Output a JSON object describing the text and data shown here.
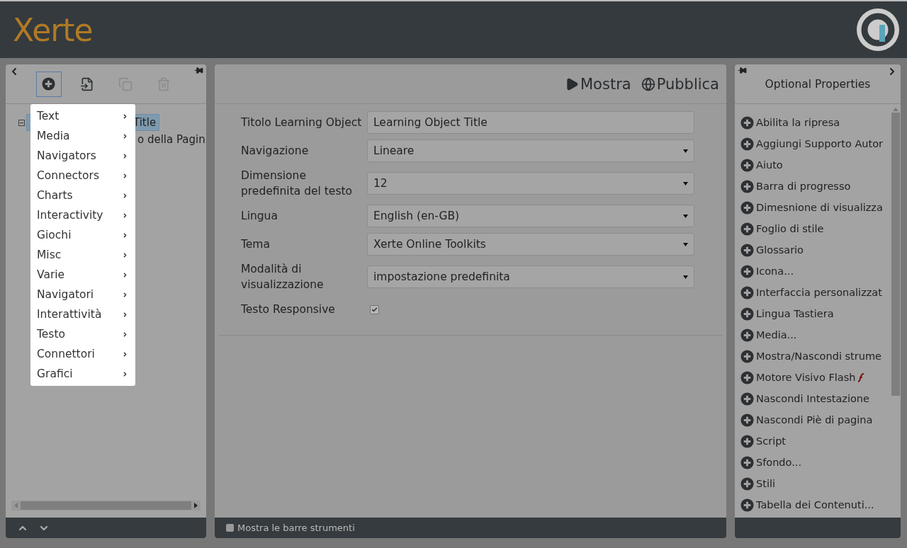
{
  "header": {
    "logo": "Xerte"
  },
  "left_panel": {
    "toolbar": [
      {
        "kind": "add",
        "disabled": false,
        "selected": true
      },
      {
        "kind": "import",
        "disabled": false,
        "selected": false
      },
      {
        "kind": "duplicate",
        "disabled": true,
        "selected": false
      },
      {
        "kind": "delete",
        "disabled": true,
        "selected": false
      }
    ],
    "tree": [
      {
        "label": "Title",
        "selected": true,
        "expanded": true,
        "children": [
          {
            "label": "o della Pagin",
            "selected": false
          }
        ]
      }
    ],
    "insert_menu": [
      "Text",
      "Media",
      "Navigators",
      "Connectors",
      "Charts",
      "Interactivity",
      "Giochi",
      "Misc",
      "Varie",
      "Navigatori",
      "Interattività",
      "Testo",
      "Connettori",
      "Grafici"
    ]
  },
  "center_panel": {
    "actions": [
      {
        "kind": "play",
        "label": "Mostra"
      },
      {
        "kind": "globe",
        "label": "Pubblica"
      }
    ],
    "fields": [
      {
        "kind": "text",
        "label": "Titolo Learning Object",
        "value": "Learning Object Title"
      },
      {
        "kind": "select",
        "label": "Navigazione",
        "value": "Lineare"
      },
      {
        "kind": "select",
        "label": "Dimensione predefinita del testo",
        "value": "12"
      },
      {
        "kind": "select",
        "label": "Lingua",
        "value": "English (en-GB)"
      },
      {
        "kind": "select",
        "label": "Tema",
        "value": "Xerte Online Toolkits"
      },
      {
        "kind": "select",
        "label": "Modalità di visualizzazione",
        "value": "impostazione predefinita"
      },
      {
        "kind": "checkbox",
        "label": "Testo Responsive",
        "checked": true
      }
    ],
    "footer": {
      "label": "Mostra le barre strumenti",
      "checked": false
    }
  },
  "right_panel": {
    "title": "Optional Properties",
    "items": [
      {
        "label": "Abilita la ripresa"
      },
      {
        "label": "Aggiungi Supporto Autor"
      },
      {
        "label": "Aiuto"
      },
      {
        "label": "Barra di progresso"
      },
      {
        "label": "Dimesnione di visualizza"
      },
      {
        "label": "Foglio di stile"
      },
      {
        "label": "Glossario"
      },
      {
        "label": "Icona..."
      },
      {
        "label": "Interfaccia personalizzat"
      },
      {
        "label": "Lingua Tastiera"
      },
      {
        "label": "Media..."
      },
      {
        "label": "Mostra/Nascondi strume"
      },
      {
        "label": "Motore Visivo Flash",
        "flash": true
      },
      {
        "label": "Nascondi Intestazione"
      },
      {
        "label": "Nascondi Piè di pagina"
      },
      {
        "label": "Script"
      },
      {
        "label": "Sfondo..."
      },
      {
        "label": "Stili"
      },
      {
        "label": "Tabella dei Contenuti..."
      }
    ]
  }
}
